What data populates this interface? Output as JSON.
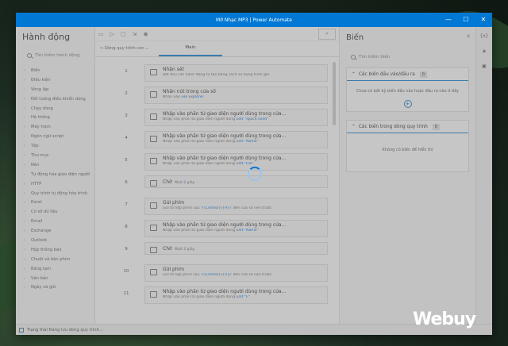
{
  "window": {
    "title": "Mở Nhạc MP3 | Power Automate",
    "controls": [
      "—",
      "☐",
      "✕"
    ]
  },
  "actions": {
    "title": "Hành động",
    "search_placeholder": "Tìm kiếm hành động",
    "categories": [
      "Biến",
      "Điều kiện",
      "Vòng lặp",
      "Đối tượng điều khiển dòng",
      "Chạy dòng",
      "Hệ thống",
      "Máy trạm",
      "Ngôn ngữ script",
      "Tệp",
      "Thư mục",
      "Nén",
      "Tự động hóa giao diện người",
      "HTTP",
      "Quy trình tự động hóa trình",
      "Excel",
      "Cơ sở dữ liệu",
      "Email",
      "Exchange",
      "Outlook",
      "Hộp thông báo",
      "Chuột và bàn phím",
      "Bảng tạm",
      "Văn bản",
      "Ngày và giờ"
    ]
  },
  "designer": {
    "subflows_label": "Dòng quy trình con",
    "main_tab": "Main",
    "steps": [
      {
        "num": "1",
        "title": "Nhận sét",
        "desc": "Bắt đầu các hành động tư tạo bằng cách sử dụng trình ghi",
        "var": ""
      },
      {
        "num": "2",
        "title": "Nhấn nút trong cửa sổ",
        "desc": "Nhấn vào ",
        "var": "File Explorer"
      },
      {
        "num": "3",
        "title": "Nhập vào phần tử giao diện người dùng trong cửa...",
        "desc": "Nhập vào phần tử giao diện người dùng ",
        "var": "Edit \"space used\""
      },
      {
        "num": "4",
        "title": "Nhập vào phần tử giao diện người dùng trong cửa...",
        "desc": "Nhập vào phần tử giao diện người dùng ",
        "var": "Edit \"Name\""
      },
      {
        "num": "5",
        "title": "Nhập vào phần tử giao diện người dùng trong cửa...",
        "desc": "Nhập vào phần tử giao diện người dùng ",
        "var": "Edit \"File\""
      },
      {
        "num": "6",
        "title": "Chờ",
        "desc": "Wait ",
        "var": "2",
        "suffix": " giây",
        "single": true
      },
      {
        "num": "7",
        "title": "Gửi phím",
        "desc": "Gửi tổ hợp phím sau ",
        "var": "'{\\Control}({A})'",
        "suffix": " đến cửa sổ nền trước"
      },
      {
        "num": "8",
        "title": "Nhập vào phần tử giao diện người dùng trong cửa...",
        "desc": "Nhập vào phần tử giao diện người dùng ",
        "var": "Edit \"Name\""
      },
      {
        "num": "9",
        "title": "Chờ",
        "desc": "Wait ",
        "var": "2",
        "suffix": " giây",
        "single": true
      },
      {
        "num": "10",
        "title": "Gửi phím",
        "desc": "Gửi tổ hợp phím sau ",
        "var": "'{\\Control}({V})'",
        "suffix": " đến cửa sổ nền trước"
      },
      {
        "num": "11",
        "title": "Nhập vào phần tử giao diện người dùng trong cửa...",
        "desc": "Nhập vào phần tử giao diện người dùng ",
        "var": "Edit \"F\""
      }
    ]
  },
  "variables": {
    "title": "Biến",
    "search_placeholder": "Tìm kiếm biến",
    "io_panel": {
      "title": "Các biến đầu vào/đầu ra",
      "count": "0",
      "empty_text": "Chưa có bất kỳ biến đầu vào hoặc đầu ra nào ở đây"
    },
    "flow_panel": {
      "title": "Các biến trong dòng quy trình",
      "count": "0",
      "empty_text": "Không có biến để hiển thị"
    }
  },
  "status": {
    "text": "Trạng thái Đang lưu dòng quy trình..."
  },
  "watermark": "Webuy"
}
